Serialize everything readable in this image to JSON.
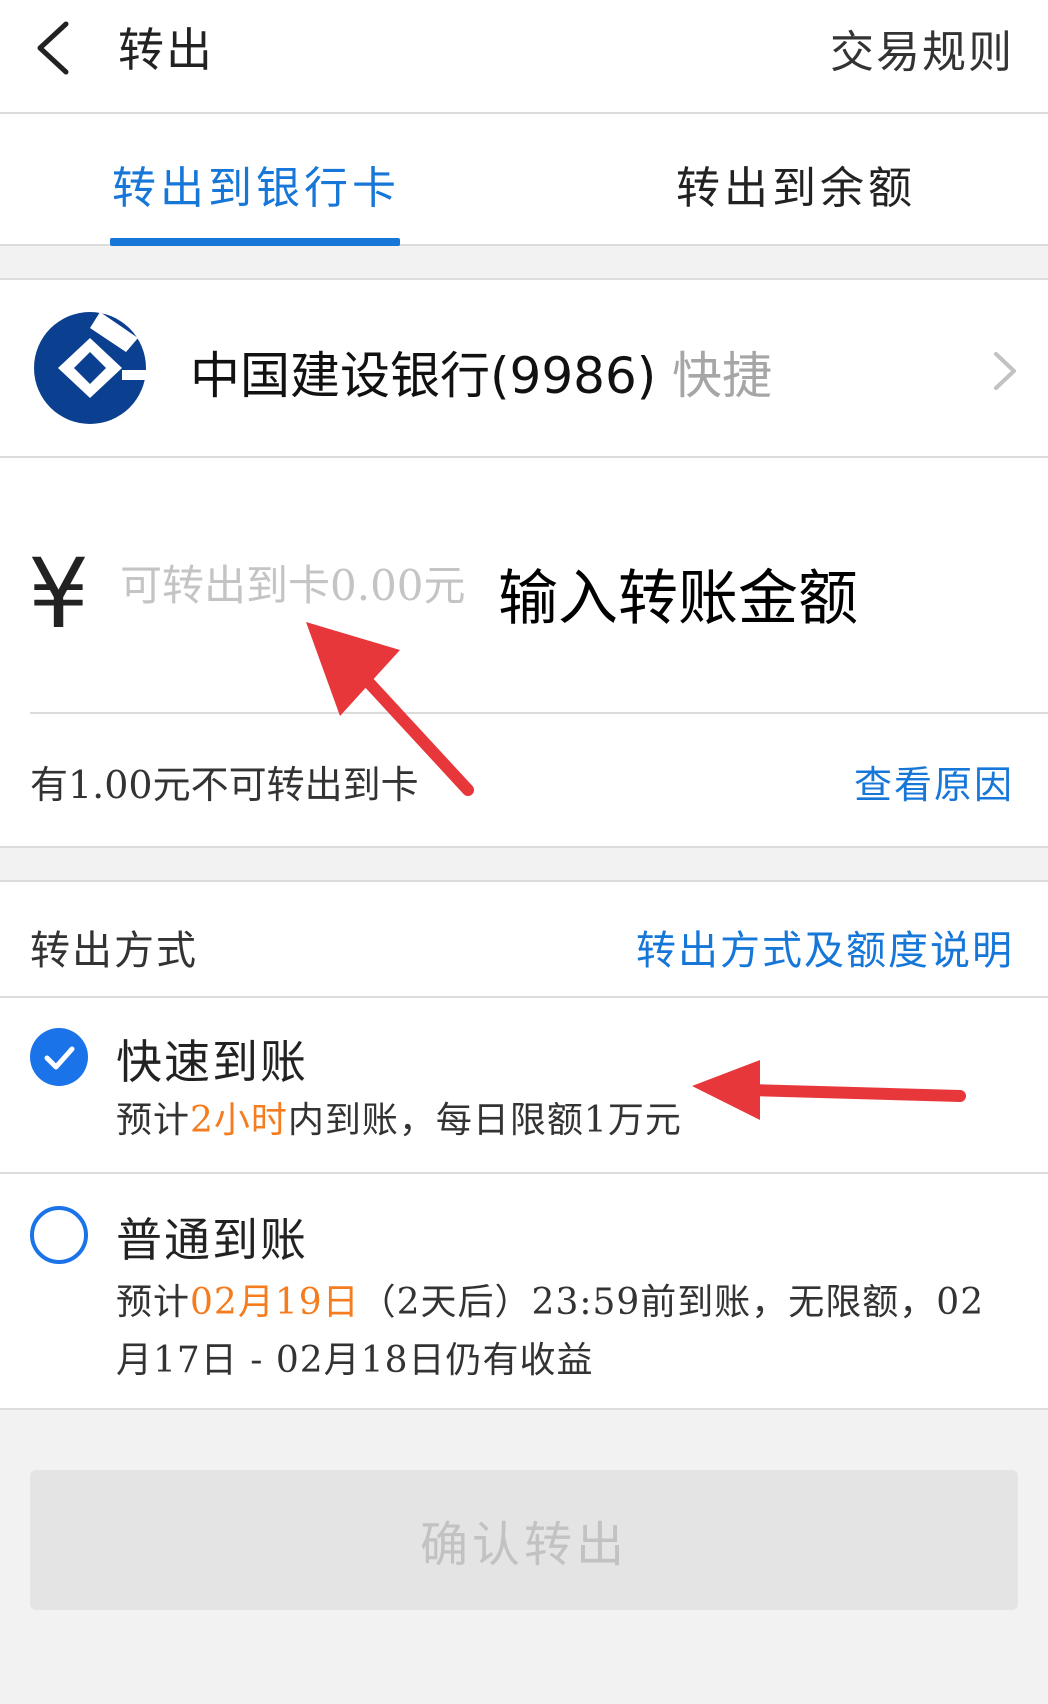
{
  "header": {
    "title": "转出",
    "rules_label": "交易规则",
    "back_icon": "chevron-left-icon"
  },
  "tabs": [
    {
      "label": "转出到银行卡",
      "active": true
    },
    {
      "label": "转出到余额",
      "active": false
    }
  ],
  "bank": {
    "name": "中国建设银行(9986)",
    "tag": "快捷",
    "logo_icon": "ccb-bank-logo-icon",
    "chevron_icon": "chevron-right-icon"
  },
  "amount": {
    "currency_symbol": "¥",
    "placeholder": "可转出到卡0.00元",
    "annotation": "输入转账金额",
    "not_transferable": "有1.00元不可转出到卡",
    "view_reason_label": "查看原因"
  },
  "method": {
    "title": "转出方式",
    "desc_link": "转出方式及额度说明",
    "options": [
      {
        "title": "快速到账",
        "checked": true,
        "desc_prefix": "预计",
        "desc_highlight": "2小时",
        "desc_suffix": "内到账，每日限额1万元"
      },
      {
        "title": "普通到账",
        "checked": false,
        "desc_prefix": "预计",
        "desc_highlight": "02月19日",
        "desc_suffix": "（2天后）23:59前到账，无限额，02月17日 - 02月18日仍有收益"
      }
    ]
  },
  "confirm_label": "确认转出",
  "colors": {
    "accent": "#1677d9",
    "highlight": "#f57c1f",
    "annotation_arrow": "#e8373b"
  }
}
